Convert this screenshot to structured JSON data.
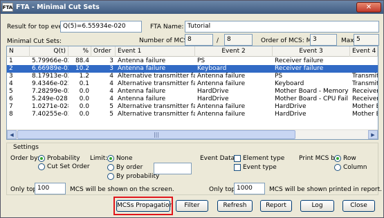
{
  "window": {
    "title": "FTA - Minimal Cut Sets",
    "close_glyph": "✕",
    "app_icon_text": "FTA"
  },
  "top": {
    "result_label": "Result for top event:",
    "result_value": "Q(5)=6.55934e-020",
    "fta_name_label": "FTA Name:",
    "fta_name_value": "Tutorial",
    "minimal_cut_sets_label": "Minimal Cut Sets:",
    "num_mcs_label": "Number of MCS:",
    "num_mcs_value": "8",
    "num_mcs_sep": "/",
    "num_mcs_total": "8",
    "order_label": "Order of MCS: Min",
    "order_min": "3",
    "order_max_label": "Max",
    "order_max": "5"
  },
  "table": {
    "columns": [
      "N",
      "Q(t)",
      "%",
      "Order",
      "Event 1",
      "Event 2",
      "Event 3",
      "Event 4"
    ],
    "rows": [
      {
        "n": "1",
        "q": "5.79966e-020",
        "pct": "88.4",
        "order": "3",
        "e1": "Antenna failure",
        "e2": "PS",
        "e3": "Receiver failure",
        "e4": ""
      },
      {
        "n": "2",
        "q": "6.66989e-021",
        "pct": "10.2",
        "order": "3",
        "e1": "Antenna failure",
        "e2": "Keyboard",
        "e3": "Receiver failure",
        "e4": ""
      },
      {
        "n": "3",
        "q": "8.17913e-022",
        "pct": "1.2",
        "order": "4",
        "e1": "Alternative transmitter failure",
        "e2": "Antenna failure",
        "e3": "PS",
        "e4": "Transmitter f"
      },
      {
        "n": "4",
        "q": "9.4346e-023",
        "pct": "0.1",
        "order": "4",
        "e1": "Alternative transmitter failure",
        "e2": "Antenna failure",
        "e3": "Keyboard",
        "e4": "Transmitter f"
      },
      {
        "n": "5",
        "q": "7.28299e-027",
        "pct": "0.0",
        "order": "4",
        "e1": "Antenna failure",
        "e2": "HardDrive",
        "e3": "Mother Board - Memory Fail",
        "e4": "Receiver failu"
      },
      {
        "n": "6",
        "q": "5.249e-028",
        "pct": "0.0",
        "order": "4",
        "e1": "Antenna failure",
        "e2": "HardDrive",
        "e3": "Mother Board - CPU Fail",
        "e4": "Receiver failu"
      },
      {
        "n": "7",
        "q": "1.0271e-028",
        "pct": "0.0",
        "order": "5",
        "e1": "Alternative transmitter failure",
        "e2": "Antenna failure",
        "e3": "HardDrive",
        "e4": "Mother Board"
      },
      {
        "n": "8",
        "q": "7.40255e-030",
        "pct": "0.0",
        "order": "5",
        "e1": "Alternative transmitter failure",
        "e2": "Antenna failure",
        "e3": "HardDrive",
        "e4": "Mother Board"
      }
    ],
    "selected_row_index": 1,
    "scroll_left": "◀",
    "scroll_right": "▶",
    "thumb_grip": "|||"
  },
  "settings": {
    "legend": "Settings",
    "order_by_label": "Order by:",
    "order_by_options": [
      "Probability",
      "Cut Set Order"
    ],
    "order_by_selected": "Probability",
    "limit_label": "Limit:",
    "limit_options": [
      "None",
      "By order",
      "By probability"
    ],
    "limit_selected": "None",
    "limit_value": "",
    "event_data_label": "Event Data:",
    "event_data_options": [
      "Element type",
      "Event type"
    ],
    "print_mcs_label": "Print MCS by",
    "print_mcs_options": [
      "Row",
      "Column"
    ],
    "print_mcs_selected": "Row",
    "only_top_label": "Only top",
    "only_top_screen_value": "100",
    "screen_suffix": "MCS will be shown on the screen.",
    "only_top_print_value": "1000",
    "print_suffix": "MCS will be shown printed in report."
  },
  "buttons": {
    "propagation": "MCSs Propagation",
    "filter": "Filter",
    "refresh": "Refresh",
    "report": "Report",
    "log": "Log",
    "close": "Close"
  },
  "colors": {
    "selection": "#316ac5",
    "highlight_box": "#e0151b"
  }
}
